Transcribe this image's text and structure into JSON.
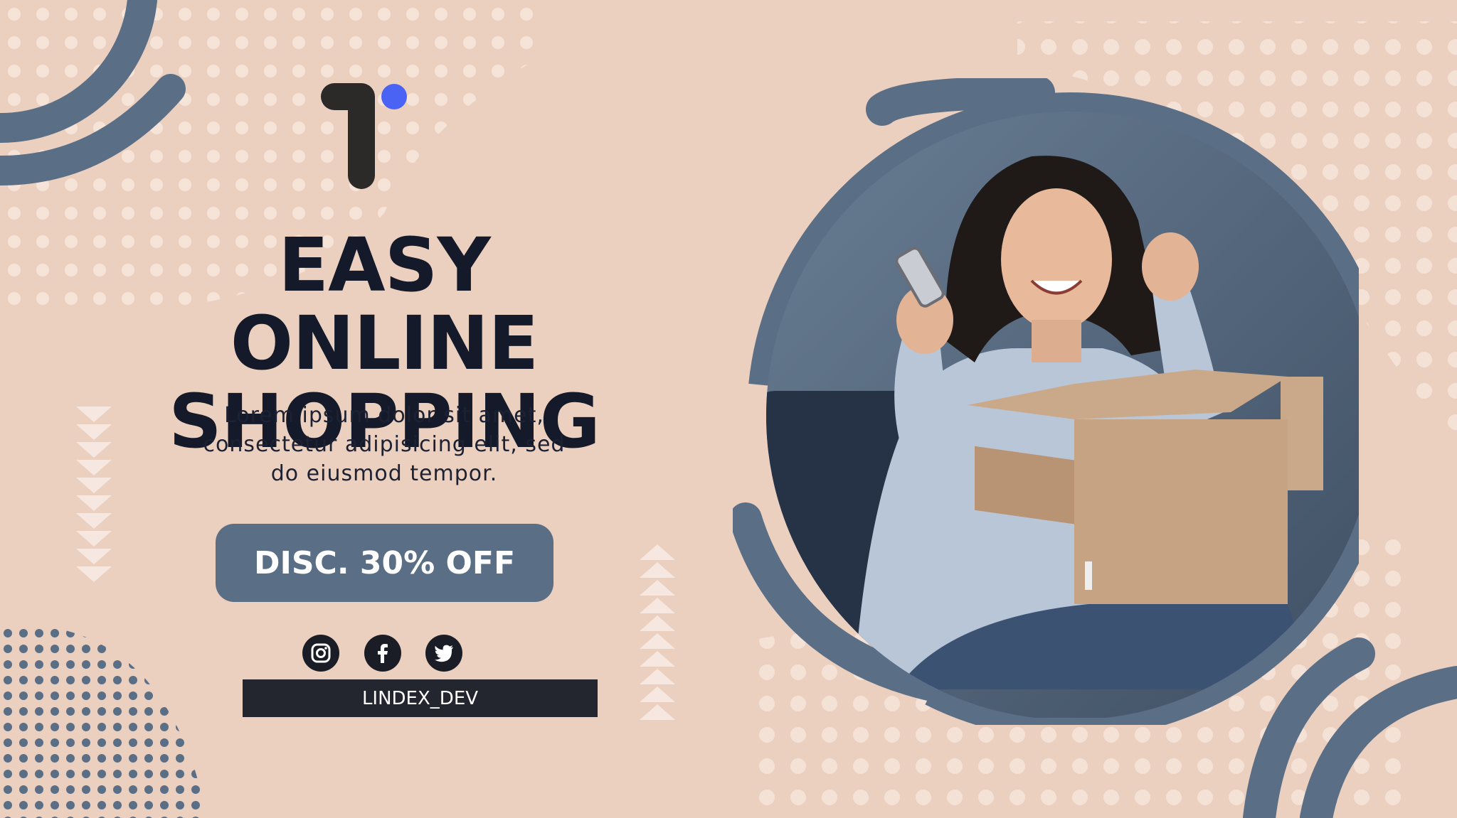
{
  "headline": {
    "line1": "EASY ONLINE",
    "line2": "SHOPPING"
  },
  "body": {
    "line1": "Lorem ipsum dolor sit amet,",
    "line2": "consectetur adipisicing elit, sed",
    "line3": "do eiusmod tempor."
  },
  "cta": {
    "label": "DISC. 30% OFF"
  },
  "social": {
    "icons": [
      "instagram-icon",
      "facebook-icon",
      "twitter-icon"
    ],
    "handle": "LINDEX_DEV"
  },
  "colors": {
    "background": "#ebcfbf",
    "accent": "#5a6e86",
    "text": "#141a29",
    "logo_dot": "#4a63f5"
  }
}
